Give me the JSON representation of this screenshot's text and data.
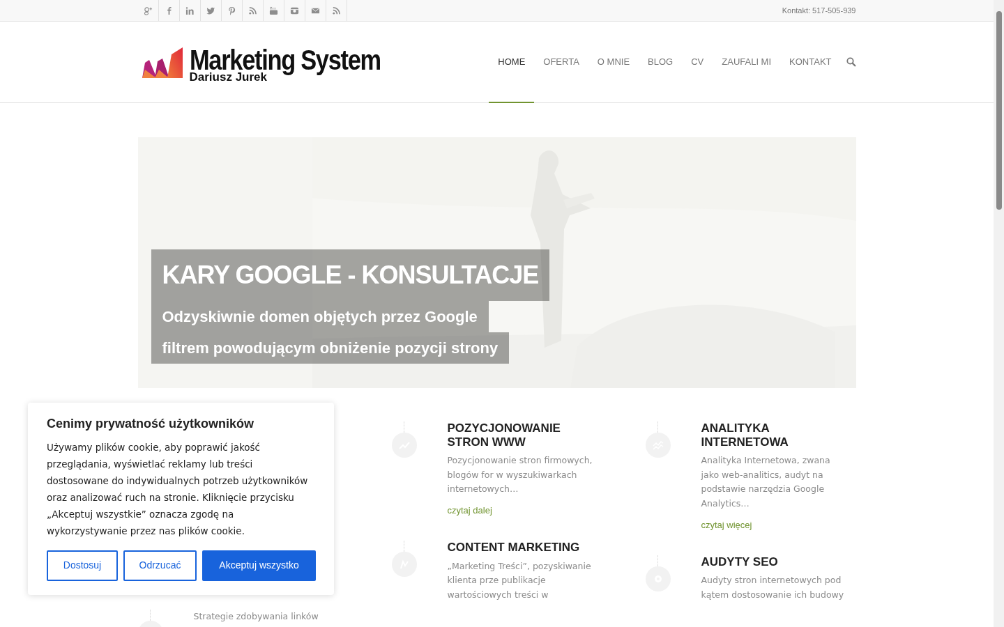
{
  "top_bar": {
    "contact": "Kontakt: 517-505-939"
  },
  "logo": {
    "title": "Marketing System",
    "subtitle": "Dariusz Jurek"
  },
  "nav": [
    {
      "label": "HOME",
      "selected": true
    },
    {
      "label": "OFERTA",
      "selected": false
    },
    {
      "label": "O MNIE",
      "selected": false
    },
    {
      "label": "BLOG",
      "selected": false
    },
    {
      "label": "CV",
      "selected": false
    },
    {
      "label": "ZAUFALI MI",
      "selected": false
    },
    {
      "label": "KONTAKT",
      "selected": false
    }
  ],
  "hero": {
    "kind": "picture",
    "title": "KARY GOOGLE - KONSULTACJE",
    "lines": [
      "Odzyskiwnie domen objętych przez Google",
      "filtrem powodującym obniżenie pozycji strony"
    ]
  },
  "columns": [
    {
      "items": [
        {
          "text": "Strategie zdobywania linków"
        }
      ]
    },
    {
      "items": [
        {
          "title": "POZYCJONOWANIE STRON WWW",
          "text": "Pozycjonowanie stron firmowych, blogów for  w wyszukiwarkach internetowych…",
          "link": "czytaj dalej"
        },
        {
          "title": "CONTENT MARKETING",
          "text": "„Marketing Treści”, pozyskiwanie klienta prze publikacje wartościowych treści w"
        }
      ]
    },
    {
      "items": [
        {
          "title": "ANALITYKA INTERNETOWA",
          "text": "Analityka Internetowa, zwana jako web-analitics, audyt na podstawie narzędzia  Google Analytics…",
          "link": "czytaj więcej"
        },
        {
          "title": "AUDYTY SEO",
          "text": "Audyty stron internetowych pod kątem dostosowanie ich budowy"
        }
      ]
    }
  ],
  "cookie": {
    "title": "Cenimy prywatność użytkowników",
    "text": "Używamy plików cookie, aby poprawić jakość przeglądania, wyświetlać reklamy lub treści dostosowane do indywidualnych potrzeb użytkowników oraz analizować ruch na stronie. Kliknięcie przycisku „Akceptuj wszystkie” oznacza zgodę na wykorzystywanie przez nas plików cookie.",
    "buttons": [
      {
        "label": "Dostosuj",
        "kind": "outline"
      },
      {
        "label": "Odrzucać",
        "kind": "outline"
      },
      {
        "label": "Akceptuj wszystko",
        "kind": "primary"
      }
    ]
  }
}
